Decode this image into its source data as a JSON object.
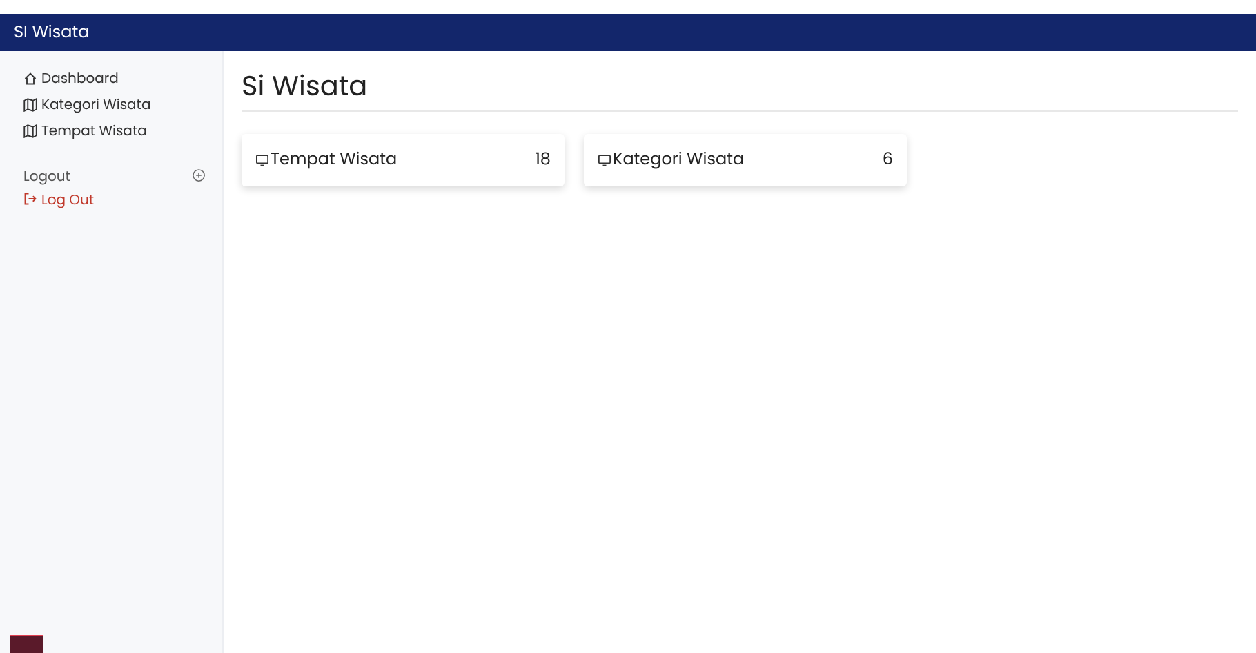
{
  "navbar": {
    "brand": "SI Wisata"
  },
  "sidebar": {
    "items": [
      {
        "label": "Dashboard",
        "kind": "home"
      },
      {
        "label": "Kategori Wisata",
        "kind": "map"
      },
      {
        "label": "Tempat Wisata",
        "kind": "map"
      }
    ],
    "section": {
      "title": "Logout",
      "logout": "Log Out"
    }
  },
  "page": {
    "title": "Si Wisata"
  },
  "cards": [
    {
      "label": "Tempat Wisata",
      "count": "18"
    },
    {
      "label": "Kategori Wisata",
      "count": "6"
    }
  ]
}
